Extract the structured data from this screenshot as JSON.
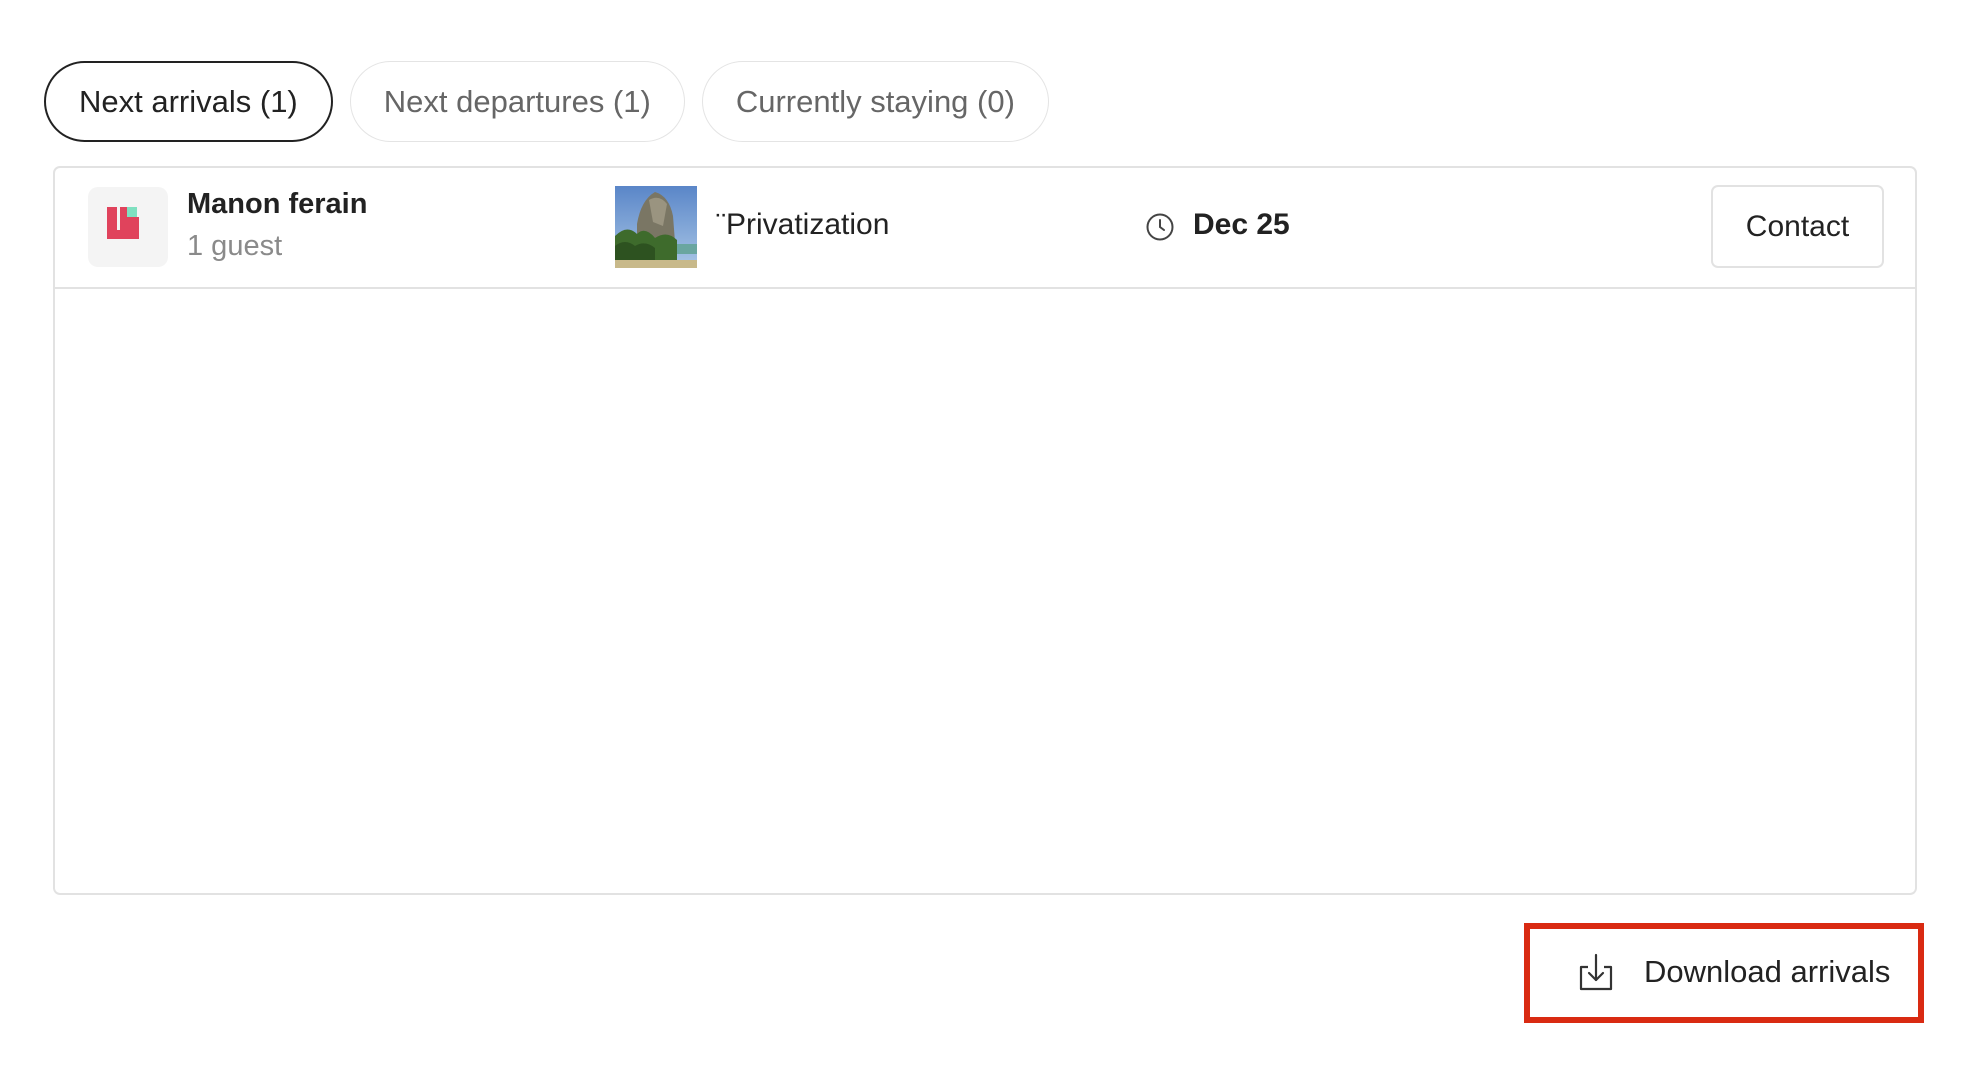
{
  "tabs": [
    {
      "label": "Next arrivals (1)",
      "active": true
    },
    {
      "label": "Next departures (1)",
      "active": false
    },
    {
      "label": "Currently staying (0)",
      "active": false
    }
  ],
  "arrivals": [
    {
      "guest_name": "Manon ferain",
      "guest_count": "1 guest",
      "listing_title": "¨Privatization",
      "date": "Dec 25",
      "contact_label": "Contact"
    }
  ],
  "actions": {
    "download_label": "Download arrivals"
  },
  "icons": {
    "avatar": "host-logo-icon",
    "clock": "clock-icon",
    "download": "download-icon"
  },
  "colors": {
    "logo_red": "#e0435c",
    "logo_mint": "#7fe0c0",
    "highlight_border": "#d92a12"
  }
}
